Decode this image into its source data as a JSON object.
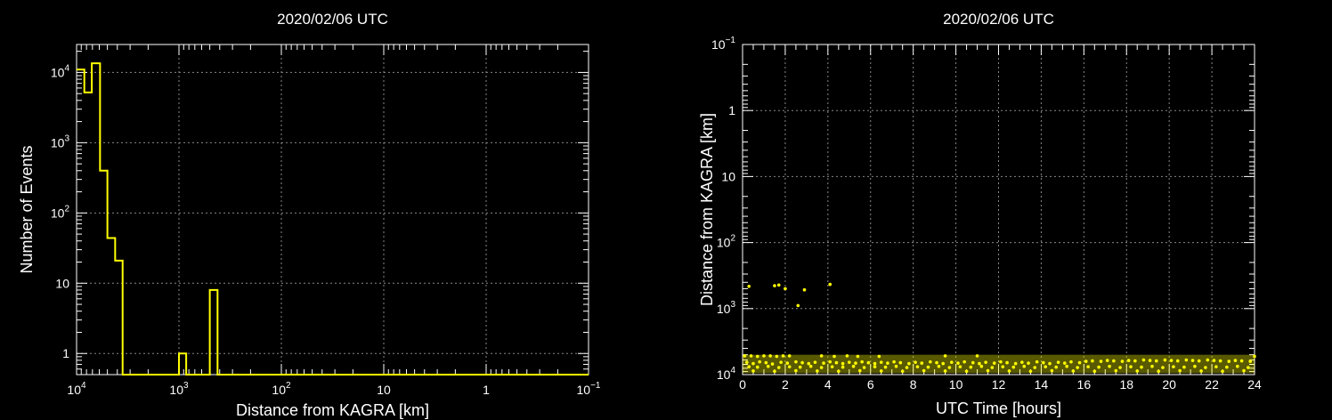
{
  "chart_data": [
    {
      "type": "histogram",
      "title": "2020/02/06 UTC",
      "xlabel": "Distance from KAGRA [km]",
      "ylabel": "Number of Events",
      "x_scale": "log",
      "x_reversed": true,
      "y_scale": "log",
      "xlim": [
        10000,
        0.1
      ],
      "ylim": [
        0.5,
        25000
      ],
      "grid": true,
      "x_ticks": [
        {
          "value": 10000,
          "base": "10",
          "exp": "4"
        },
        {
          "value": 1000,
          "base": "10",
          "exp": "3"
        },
        {
          "value": 100,
          "base": "10",
          "exp": "2"
        },
        {
          "value": 10,
          "base": "10",
          "exp": ""
        },
        {
          "value": 1,
          "base": "1",
          "exp": ""
        },
        {
          "value": 0.1,
          "base": "10",
          "exp": "−1"
        }
      ],
      "y_ticks": [
        {
          "value": 1,
          "base": "1",
          "exp": ""
        },
        {
          "value": 10,
          "base": "10",
          "exp": ""
        },
        {
          "value": 100,
          "base": "10",
          "exp": "2"
        },
        {
          "value": 1000,
          "base": "10",
          "exp": "3"
        },
        {
          "value": 10000,
          "base": "10",
          "exp": "4"
        }
      ],
      "bins": [
        {
          "x0": 10000,
          "x1": 8400,
          "count": 11000
        },
        {
          "x0": 8400,
          "x1": 7100,
          "count": 5200
        },
        {
          "x0": 7100,
          "x1": 5900,
          "count": 13500
        },
        {
          "x0": 5900,
          "x1": 5000,
          "count": 400
        },
        {
          "x0": 5000,
          "x1": 4200,
          "count": 44
        },
        {
          "x0": 4200,
          "x1": 3550,
          "count": 21
        },
        {
          "x0": 3550,
          "x1": 1000,
          "count": 0
        },
        {
          "x0": 1000,
          "x1": 850,
          "count": 1
        },
        {
          "x0": 850,
          "x1": 500,
          "count": 0
        },
        {
          "x0": 500,
          "x1": 420,
          "count": 8
        },
        {
          "x0": 420,
          "x1": 0.1,
          "count": 0
        }
      ]
    },
    {
      "type": "scatter",
      "title": "2020/02/06 UTC",
      "xlabel": "UTC Time [hours]",
      "ylabel": "Distance from KAGRA [km]",
      "x_scale": "linear",
      "y_scale": "log",
      "y_reversed": true,
      "xlim": [
        0,
        24
      ],
      "ylim": [
        0.1,
        10000
      ],
      "grid": true,
      "color": "#ffff00",
      "x_ticks": [
        "0",
        "2",
        "4",
        "6",
        "8",
        "10",
        "12",
        "14",
        "16",
        "18",
        "20",
        "22",
        "24"
      ],
      "y_ticks": [
        {
          "value": 0.1,
          "base": "10",
          "exp": "−1"
        },
        {
          "value": 1,
          "base": "1",
          "exp": ""
        },
        {
          "value": 10,
          "base": "10",
          "exp": ""
        },
        {
          "value": 100,
          "base": "10",
          "exp": "2"
        },
        {
          "value": 1000,
          "base": "10",
          "exp": "3"
        },
        {
          "value": 10000,
          "base": "10",
          "exp": "4"
        }
      ],
      "points": [
        [
          0.3,
          460
        ],
        [
          1.5,
          450
        ],
        [
          1.7,
          440
        ],
        [
          2.0,
          500
        ],
        [
          2.6,
          900
        ],
        [
          2.9,
          520
        ],
        [
          4.1,
          430
        ],
        [
          0.1,
          5200
        ],
        [
          0.4,
          5200
        ],
        [
          0.7,
          5300
        ],
        [
          1.0,
          5200
        ],
        [
          1.3,
          5200
        ],
        [
          1.6,
          5300
        ],
        [
          1.9,
          5200
        ],
        [
          2.2,
          5200
        ],
        [
          3.7,
          5200
        ],
        [
          4.3,
          5300
        ],
        [
          4.9,
          5200
        ],
        [
          5.4,
          5300
        ],
        [
          6.4,
          5300
        ],
        [
          9.5,
          5200
        ],
        [
          11.0,
          5200
        ],
        [
          24.0,
          5300
        ],
        [
          0.2,
          6500
        ],
        [
          0.5,
          6800
        ],
        [
          0.8,
          6400
        ],
        [
          1.1,
          6600
        ],
        [
          1.4,
          6900
        ],
        [
          1.8,
          6500
        ],
        [
          2.1,
          6700
        ],
        [
          2.5,
          6400
        ],
        [
          2.8,
          6600
        ],
        [
          3.1,
          6800
        ],
        [
          3.4,
          6500
        ],
        [
          3.8,
          6700
        ],
        [
          4.1,
          6400
        ],
        [
          4.4,
          6600
        ],
        [
          4.7,
          6800
        ],
        [
          5.0,
          6500
        ],
        [
          5.3,
          6700
        ],
        [
          5.6,
          6400
        ],
        [
          5.9,
          6600
        ],
        [
          6.2,
          6800
        ],
        [
          6.5,
          6500
        ],
        [
          6.8,
          6700
        ],
        [
          7.1,
          6400
        ],
        [
          7.4,
          6600
        ],
        [
          7.8,
          6800
        ],
        [
          8.1,
          6500
        ],
        [
          8.4,
          6700
        ],
        [
          8.8,
          6400
        ],
        [
          9.1,
          6600
        ],
        [
          9.4,
          6800
        ],
        [
          9.8,
          6500
        ],
        [
          10.1,
          6700
        ],
        [
          10.4,
          6400
        ],
        [
          10.8,
          6600
        ],
        [
          11.1,
          6800
        ],
        [
          11.4,
          6500
        ],
        [
          11.8,
          6700
        ],
        [
          12.1,
          6400
        ],
        [
          12.4,
          6600
        ],
        [
          12.8,
          6800
        ],
        [
          13.1,
          6500
        ],
        [
          13.4,
          6700
        ],
        [
          13.8,
          6400
        ],
        [
          14.1,
          6600
        ],
        [
          14.4,
          6800
        ],
        [
          14.8,
          6500
        ],
        [
          15.1,
          6700
        ],
        [
          15.4,
          6400
        ],
        [
          15.8,
          6600
        ],
        [
          16.1,
          6300
        ],
        [
          16.4,
          6200
        ],
        [
          16.8,
          6300
        ],
        [
          17.1,
          6100
        ],
        [
          17.4,
          6200
        ],
        [
          17.8,
          6300
        ],
        [
          18.1,
          6100
        ],
        [
          18.4,
          6200
        ],
        [
          18.8,
          6000
        ],
        [
          19.1,
          6100
        ],
        [
          19.4,
          6200
        ],
        [
          19.8,
          6000
        ],
        [
          20.1,
          6100
        ],
        [
          20.4,
          6200
        ],
        [
          20.8,
          6000
        ],
        [
          21.1,
          6100
        ],
        [
          21.4,
          6200
        ],
        [
          21.8,
          6000
        ],
        [
          22.1,
          6100
        ],
        [
          22.4,
          6200
        ],
        [
          22.8,
          6300
        ],
        [
          23.1,
          6100
        ],
        [
          23.4,
          6200
        ],
        [
          23.8,
          6300
        ],
        [
          0.3,
          7600
        ],
        [
          0.7,
          7700
        ],
        [
          1.2,
          7500
        ],
        [
          1.7,
          7800
        ],
        [
          2.2,
          7600
        ],
        [
          2.7,
          7700
        ],
        [
          3.2,
          7500
        ],
        [
          3.7,
          7800
        ],
        [
          4.2,
          7600
        ],
        [
          4.7,
          7700
        ],
        [
          5.2,
          7500
        ],
        [
          5.7,
          7800
        ],
        [
          6.2,
          7600
        ],
        [
          6.7,
          7700
        ],
        [
          7.2,
          7500
        ],
        [
          7.7,
          7800
        ],
        [
          8.2,
          7600
        ],
        [
          8.7,
          7700
        ],
        [
          9.2,
          7500
        ],
        [
          9.7,
          7800
        ],
        [
          10.2,
          7600
        ],
        [
          10.7,
          7700
        ],
        [
          11.2,
          7500
        ],
        [
          11.7,
          7800
        ],
        [
          12.2,
          7600
        ],
        [
          12.7,
          7700
        ],
        [
          13.2,
          7500
        ],
        [
          13.7,
          7800
        ],
        [
          14.2,
          7600
        ],
        [
          14.7,
          7700
        ],
        [
          15.2,
          7500
        ],
        [
          15.7,
          7800
        ],
        [
          16.2,
          7600
        ],
        [
          16.7,
          7700
        ],
        [
          17.2,
          7500
        ],
        [
          17.7,
          7800
        ],
        [
          18.2,
          7600
        ],
        [
          18.7,
          7700
        ],
        [
          19.2,
          7500
        ],
        [
          19.7,
          7800
        ],
        [
          20.2,
          7600
        ],
        [
          20.7,
          7700
        ],
        [
          21.2,
          7500
        ],
        [
          21.7,
          7800
        ],
        [
          22.2,
          7600
        ],
        [
          22.7,
          7700
        ],
        [
          23.2,
          7500
        ],
        [
          23.7,
          7800
        ],
        [
          0.5,
          8800
        ],
        [
          1.5,
          8900
        ],
        [
          2.5,
          8700
        ],
        [
          3.5,
          8800
        ],
        [
          4.5,
          8900
        ],
        [
          5.5,
          8700
        ],
        [
          6.5,
          8800
        ],
        [
          7.5,
          8900
        ],
        [
          8.5,
          8700
        ],
        [
          9.5,
          8800
        ],
        [
          10.5,
          8900
        ],
        [
          11.5,
          8700
        ],
        [
          12.5,
          8800
        ],
        [
          13.5,
          8900
        ],
        [
          14.5,
          8700
        ],
        [
          15.5,
          8800
        ],
        [
          16.5,
          8900
        ],
        [
          17.5,
          8700
        ],
        [
          18.5,
          8800
        ],
        [
          19.5,
          8900
        ],
        [
          20.5,
          8700
        ],
        [
          21.5,
          8800
        ],
        [
          22.5,
          8900
        ],
        [
          23.5,
          8700
        ]
      ]
    }
  ]
}
